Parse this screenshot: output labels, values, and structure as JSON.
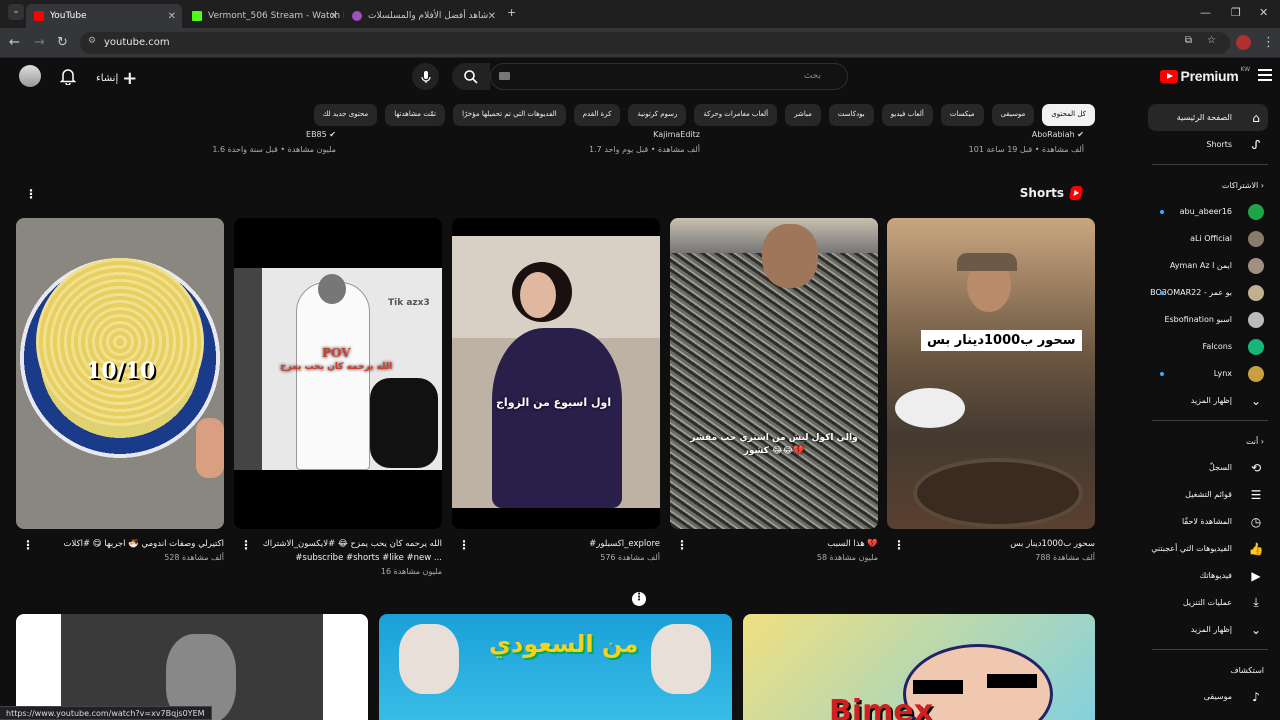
{
  "tabs": [
    {
      "title": "YouTube",
      "active": true
    },
    {
      "title": "Vermont_506 Stream - Watch L",
      "active": false
    },
    {
      "title": "شاهد أفضل الأفلام والمسلسلات",
      "active": false
    }
  ],
  "address": {
    "url": "youtube.com"
  },
  "header": {
    "logo_text": "Premium",
    "country_code": "KW",
    "search_placeholder": "بحث",
    "create_label": "إنشاء"
  },
  "chips": [
    "كل المحتوى",
    "موسيقى",
    "ميكسات",
    "ألعاب فيديو",
    "بودكاست",
    "مباشر",
    "ألعاب مغامرات وحركة",
    "رسوم كرتونية",
    "كرة القدم",
    "الفديوهات التي تم تحميلها مؤخرًا",
    "تمّت مشاهدتها",
    "محتوى جديد لك"
  ],
  "prev_row": [
    {
      "channel": "AboRabiah",
      "meta": "101 ألف مشاهدة • قبل 19 ساعة"
    },
    {
      "channel": "KajimaEditz",
      "meta": "1.7 ألف مشاهدة • قبل يوم واحد"
    },
    {
      "channel": "EB85",
      "meta": "1.6 مليون مشاهدة • قبل سنة واحدة"
    }
  ],
  "shorts": {
    "title": "Shorts",
    "items": [
      {
        "title": "سحور ب1000دينار بس",
        "views": "788 ألف مشاهدة",
        "overlay": "سحور ب1000دينار بس"
      },
      {
        "title": "هذا السبب 💔",
        "views": "58 مليون مشاهدة",
        "overlay": "والي اكول ليش من اشتري حب مقشر كشور 😂😂💔"
      },
      {
        "title": "#اكسبلور_explore",
        "views": "576 ألف مشاهدة",
        "overlay": "اول اسبوع من الزواج"
      },
      {
        "title": "الله يرحمه كان يحب يمزح 😂 #لايكسون_الاشتراك #subscribe #shorts #like #new ...",
        "views": "16 مليون مشاهدة",
        "overlay": "POV",
        "overlay2": "الله يرحمه كان يحب يمزح",
        "tag": "Tik azx3"
      },
      {
        "title": "اكتيرلي وصفات اندومي 🍜 اجربها 😋 #اكلات",
        "views": "528 ألف مشاهدة",
        "overlay": "10/10"
      }
    ]
  },
  "sidebar": {
    "home": "الصفحة الرئيسية",
    "shorts": "Shorts",
    "subs_header": "الاشتراكات",
    "subs": [
      {
        "name": "abu_abeer16",
        "color": "#1ea446"
      },
      {
        "name": "aLi Official",
        "color": "#8a7a6a"
      },
      {
        "name": "Ayman Az l ايمن",
        "color": "#a09080"
      },
      {
        "name": "BO3OMAR22 - بو عمر",
        "color": "#c0b090"
      },
      {
        "name": "Esbofination اسبو",
        "color": "#bbbbbb"
      },
      {
        "name": "Falcons",
        "color": "#18b57a"
      },
      {
        "name": "Lynx",
        "color": "#c8a040"
      }
    ],
    "show_more": "إظهار المزيد",
    "you_header": "أنت",
    "you": [
      {
        "label": "السجلّ",
        "icon": "history-icon"
      },
      {
        "label": "قوائم التشغيل",
        "icon": "playlist-icon"
      },
      {
        "label": "المشاهدة لاحقًا",
        "icon": "clock-icon"
      },
      {
        "label": "الفيديوهات التي أعجبتني",
        "icon": "thumbs-up-icon"
      },
      {
        "label": "فيديوهاتك",
        "icon": "video-icon"
      },
      {
        "label": "عمليات التنزيل",
        "icon": "download-icon"
      },
      {
        "label": "إظهار المزيد",
        "icon": "chevron-down-icon"
      }
    ],
    "explore_header": "استكشاف",
    "explore": [
      {
        "label": "موسيقى",
        "icon": "music-icon"
      }
    ]
  },
  "bottom_row": [
    "",
    "من السعودي",
    "Bimex"
  ],
  "status_url": "https://www.youtube.com/watch?v=xv7Bqjs0YEM"
}
